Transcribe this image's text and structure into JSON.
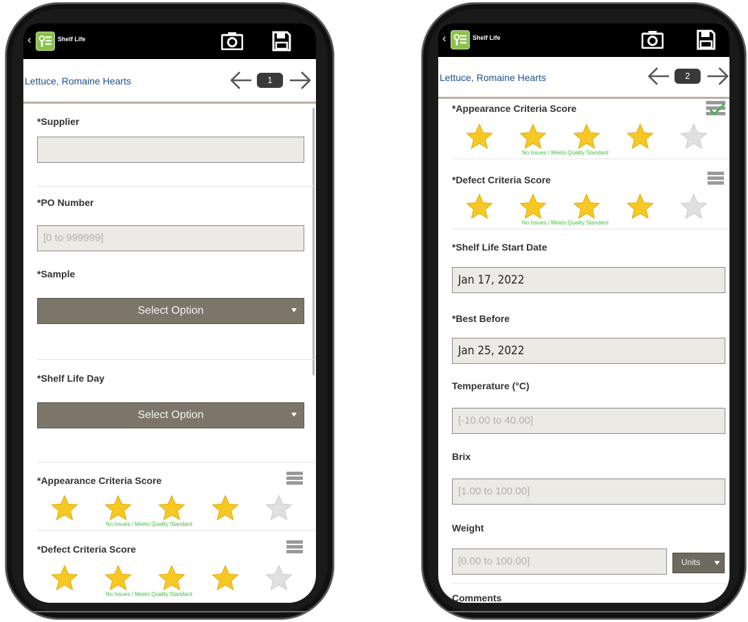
{
  "colors": {
    "star_on": "#f7c823",
    "star_off": "#e0e0e0",
    "caption_green": "#3cbf3c",
    "link_blue": "#1e4f8c",
    "select_bg": "#7c766a"
  },
  "app": {
    "back_icon": "chevron-left-icon",
    "title": "Shelf Life",
    "camera_icon": "camera-icon",
    "save_icon": "save-icon"
  },
  "screen1": {
    "product": "Lettuce, Romaine Hearts",
    "page": "1",
    "supplier": {
      "label": "*Supplier",
      "value": ""
    },
    "po": {
      "label": "*PO Number",
      "placeholder": "[0 to 999999]"
    },
    "sample": {
      "label": "*Sample",
      "select": "Select Option"
    },
    "shelf_day": {
      "label": "*Shelf Life Day",
      "select": "Select Option"
    },
    "appearance": {
      "label": "*Appearance Criteria Score",
      "rating": 4,
      "max": 5,
      "caption": "No Issues / Meets Quality Standard"
    },
    "defect": {
      "label": "*Defect Criteria Score",
      "rating": 4,
      "max": 5,
      "caption": "No Issues / Meets Quality Standard"
    }
  },
  "screen2": {
    "product": "Lettuce, Romaine Hearts",
    "page": "2",
    "appearance": {
      "label": "*Appearance Criteria Score",
      "rating": 4,
      "max": 5,
      "caption": "No Issues / Meets Quality Standard"
    },
    "defect": {
      "label": "*Defect Criteria Score",
      "rating": 4,
      "max": 5,
      "caption": "No Issues / Meets Quality Standard"
    },
    "start_date": {
      "label": "*Shelf Life Start Date",
      "value": "Jan 17, 2022"
    },
    "best_before": {
      "label": "*Best Before",
      "value": "Jan 25, 2022"
    },
    "temperature": {
      "label": "Temperature (°C)",
      "placeholder": "[-10.00 to 40.00]"
    },
    "brix": {
      "label": "Brix",
      "placeholder": "[1.00 to 100.00]"
    },
    "weight": {
      "label": "Weight",
      "placeholder": "[0.00 to 100.00]",
      "units": "Units"
    },
    "comments": {
      "label": "Comments"
    }
  }
}
